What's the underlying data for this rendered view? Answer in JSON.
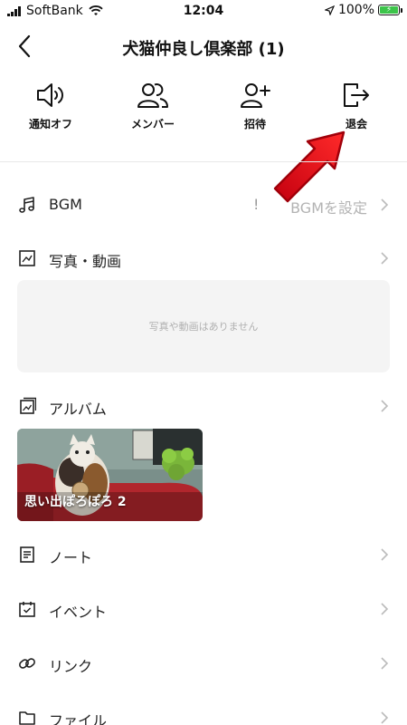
{
  "status": {
    "carrier": "SoftBank",
    "time": "12:04",
    "battery": "100%"
  },
  "header": {
    "title": "犬猫仲良し倶楽部 (1)"
  },
  "actions": [
    {
      "label": "通知オフ",
      "icon": "speaker-icon"
    },
    {
      "label": "メンバー",
      "icon": "members-icon"
    },
    {
      "label": "招待",
      "icon": "invite-icon"
    },
    {
      "label": "退会",
      "icon": "leave-icon"
    }
  ],
  "menu": {
    "bgm": {
      "label": "BGM",
      "warning": "!",
      "value": "BGMを設定"
    },
    "photos": {
      "label": "写真・動画",
      "empty_text": "写真や動画はありません"
    },
    "album": {
      "label": "アルバム",
      "album_title": "思い出ぽろぽろ",
      "album_count": "2"
    },
    "note": {
      "label": "ノート"
    },
    "event": {
      "label": "イベント"
    },
    "link": {
      "label": "リンク"
    },
    "file": {
      "label": "ファイル"
    }
  },
  "colors": {
    "accent_arrow": "#e60012",
    "battery": "#3cc44a",
    "divider": "#e8e8e8",
    "empty_bg": "#f4f4f4"
  }
}
